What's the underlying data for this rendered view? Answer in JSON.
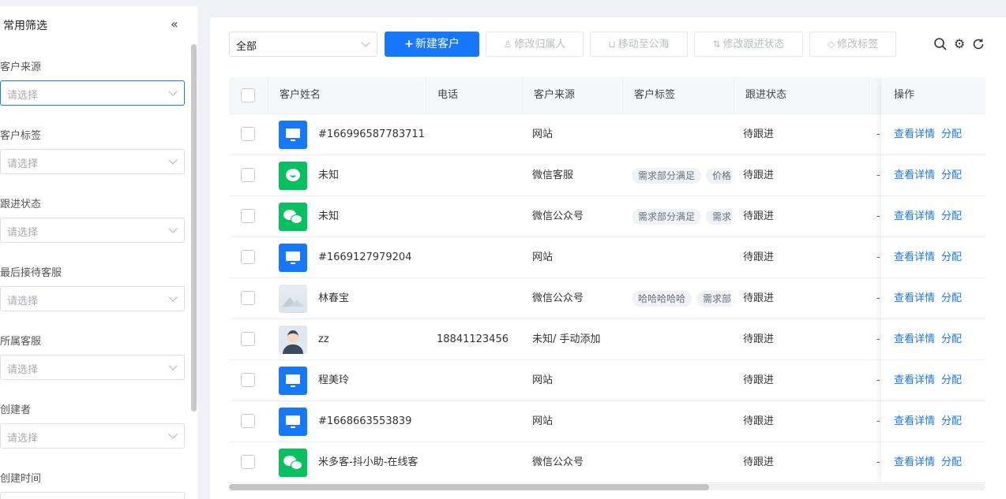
{
  "sidebar": {
    "title": "常用筛选",
    "collapse_icon": "double-chevron-left-icon",
    "filters": [
      {
        "label": "客户来源",
        "placeholder": "请选择"
      },
      {
        "label": "客户标签",
        "placeholder": "请选择"
      },
      {
        "label": "跟进状态",
        "placeholder": "请选择"
      },
      {
        "label": "最后接待客服",
        "placeholder": "请选择"
      },
      {
        "label": "所属客服",
        "placeholder": "请选择"
      },
      {
        "label": "创建者",
        "placeholder": "请选择"
      },
      {
        "label": "创建时间",
        "placeholder": ""
      }
    ]
  },
  "toolbar": {
    "scope_select": "全部",
    "new_customer": "新建客户",
    "change_owner": "修改归属人",
    "move_to_pool": "移动至公海",
    "change_status": "修改跟进状态",
    "change_tags": "修改标签"
  },
  "table": {
    "headers": {
      "name": "客户姓名",
      "phone": "电话",
      "source": "客户来源",
      "tags": "客户标签",
      "status": "跟进状态",
      "actions": "操作"
    },
    "action_labels": {
      "detail": "查看详情",
      "assign": "分配"
    },
    "rows": [
      {
        "avatar": "computer-avatar",
        "name": "#166996587783711",
        "phone": "",
        "source": "网站",
        "tags": [],
        "status": "待跟进",
        "extra": "-"
      },
      {
        "avatar": "wecom-avatar",
        "name": "未知",
        "phone": "",
        "source": "微信客服",
        "tags": [
          "需求部分满足",
          "价格"
        ],
        "status": "待跟进",
        "extra": "-"
      },
      {
        "avatar": "wechat-avatar",
        "name": "未知",
        "phone": "",
        "source": "微信公众号",
        "tags": [
          "需求部分满足",
          "需求"
        ],
        "status": "待跟进",
        "extra": "-"
      },
      {
        "avatar": "computer-avatar",
        "name": "#1669127979204",
        "phone": "",
        "source": "网站",
        "tags": [],
        "status": "待跟进",
        "extra": "-"
      },
      {
        "avatar": "image-avatar",
        "name": "林春宝",
        "phone": "",
        "source": "微信公众号",
        "tags": [
          "哈哈哈哈哈",
          "需求部"
        ],
        "status": "待跟进",
        "extra": "-"
      },
      {
        "avatar": "person-avatar",
        "name": "zz",
        "phone": "18841123456",
        "source": "未知/ 手动添加",
        "tags": [],
        "status": "待跟进",
        "extra": "-"
      },
      {
        "avatar": "computer-avatar",
        "name": "程美玲",
        "phone": "",
        "source": "网站",
        "tags": [],
        "status": "待跟进",
        "extra": "-"
      },
      {
        "avatar": "computer-avatar",
        "name": "#1668663553839",
        "phone": "",
        "source": "网站",
        "tags": [],
        "status": "待跟进",
        "extra": "-"
      },
      {
        "avatar": "wechat-avatar",
        "name": "米多客-抖小助-在线客",
        "phone": "",
        "source": "微信公众号",
        "tags": [],
        "status": "待跟进",
        "extra": "-"
      }
    ]
  },
  "colors": {
    "primary": "#1677ff",
    "wechat": "#07c160"
  }
}
